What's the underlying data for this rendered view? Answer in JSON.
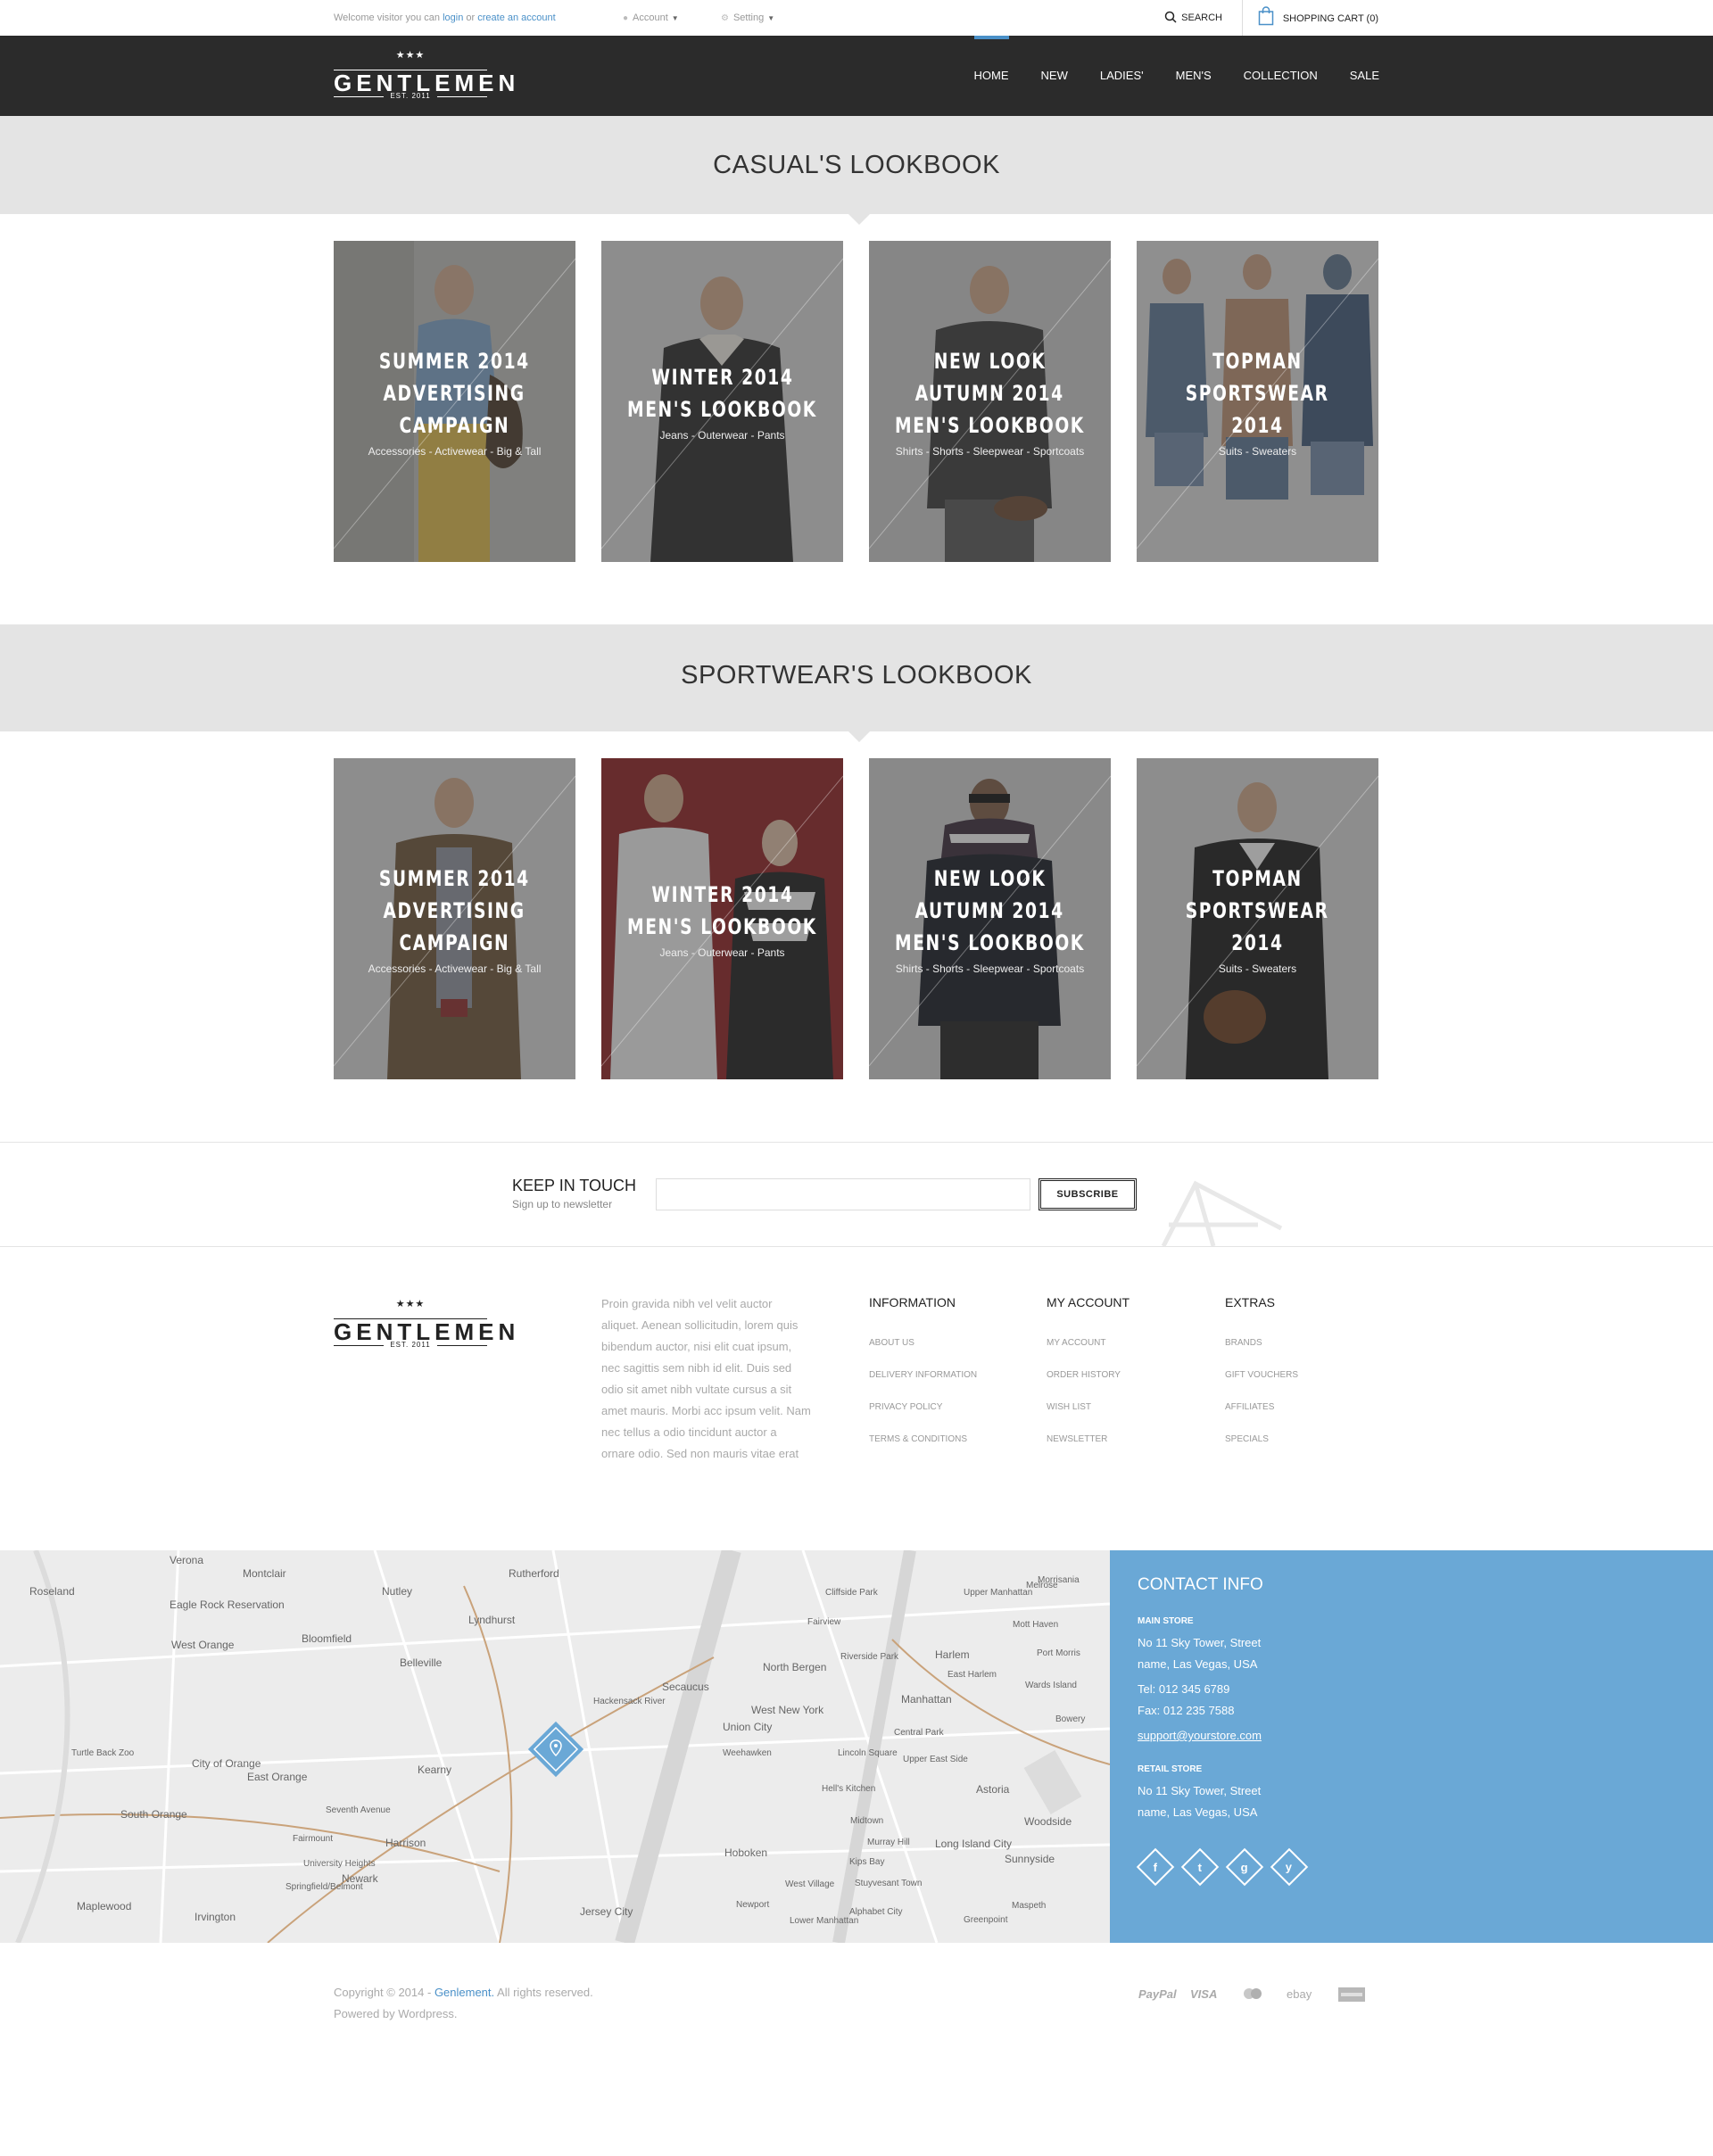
{
  "topbar": {
    "welcome_prefix": "Welcome visitor you can",
    "login": "login",
    "or": "or",
    "create_account": "create an account",
    "account": "Account",
    "setting": "Setting",
    "search": "SEARCH",
    "cart": "SHOPPING CART (0)"
  },
  "brand": {
    "stars": "★★★",
    "name": "GENTLEMEN",
    "est": "EST. 2011"
  },
  "nav": {
    "items": [
      "HOME",
      "NEW",
      "LADIES'",
      "MEN'S",
      "COLLECTION",
      "SALE"
    ]
  },
  "casual": {
    "title": "CASUAL'S LOOKBOOK",
    "cards": [
      {
        "l1": "SUMMER 2014",
        "l2": "ADVERTISING",
        "l3": "CAMPAIGN",
        "sub": "Accessories - Activewear - Big & Tall"
      },
      {
        "l1": "WINTER 2014",
        "l2": "MEN'S LOOKBOOK",
        "l3": "",
        "sub": "Jeans - Outerwear - Pants"
      },
      {
        "l1": "NEW LOOK",
        "l2": "AUTUMN 2014",
        "l3": "MEN'S LOOKBOOK",
        "sub": "Shirts - Shorts - Sleepwear - Sportcoats"
      },
      {
        "l1": "TOPMAN",
        "l2": "SPORTSWEAR",
        "l3": "2014",
        "sub": "Suits - Sweaters"
      }
    ]
  },
  "sport": {
    "title": "SPORTWEAR'S LOOKBOOK",
    "cards": [
      {
        "l1": "SUMMER 2014",
        "l2": "ADVERTISING",
        "l3": "CAMPAIGN",
        "sub": "Accessories - Activewear - Big & Tall"
      },
      {
        "l1": "WINTER 2014",
        "l2": "MEN'S LOOKBOOK",
        "l3": "",
        "sub": "Jeans - Outerwear - Pants"
      },
      {
        "l1": "NEW LOOK",
        "l2": "AUTUMN 2014",
        "l3": "MEN'S LOOKBOOK",
        "sub": "Shirts - Shorts - Sleepwear - Sportcoats"
      },
      {
        "l1": "TOPMAN",
        "l2": "SPORTSWEAR",
        "l3": "2014",
        "sub": "Suits - Sweaters"
      }
    ]
  },
  "newsletter": {
    "title": "KEEP IN TOUCH",
    "subtitle": "Sign up to newsletter",
    "placeholder": "",
    "button": "SUBSCRIBE"
  },
  "footer": {
    "about": "Proin gravida nibh vel velit auctor aliquet. Aenean sollicitudin, lorem quis bibendum auctor, nisi elit cuat ipsum, nec sagittis sem nibh id elit. Duis sed odio sit amet nibh vultate cursus a sit amet mauris. Morbi acc ipsum velit. Nam nec tellus a odio tincidunt auctor a ornare odio. Sed non  mauris vitae erat",
    "columns": [
      {
        "title": "INFORMATION",
        "links": [
          "ABOUT US",
          "DELIVERY INFORMATION",
          "PRIVACY POLICY",
          "TERMS & CONDITIONS"
        ]
      },
      {
        "title": "MY ACCOUNT",
        "links": [
          "MY ACCOUNT",
          "ORDER HISTORY",
          "WISH LIST",
          "NEWSLETTER"
        ]
      },
      {
        "title": "EXTRAS",
        "links": [
          "BRANDS",
          "GIFT VOUCHERS",
          "AFFILIATES",
          "SPECIALS"
        ]
      }
    ]
  },
  "map": {
    "labels": [
      "Verona",
      "Montclair",
      "Rutherford",
      "Nutley",
      "Lyndhurst",
      "Bloomfield",
      "West Orange",
      "Belleville",
      "Kearny",
      "East Orange",
      "Newark",
      "Harrison",
      "City of Orange",
      "South Orange",
      "Maplewood",
      "Irvington",
      "Secaucus",
      "Union City",
      "West New York",
      "North Bergen",
      "Hoboken",
      "Jersey City",
      "Manhattan",
      "Harlem",
      "Astoria",
      "Long Island City",
      "Sunnyside",
      "Woodside",
      "Roseland",
      "Eagle Rock Reservation",
      "Turtle Back Zoo",
      "Upper Manhattan",
      "Cliffside Park",
      "Fairview",
      "Weehawken",
      "Hell's Kitchen",
      "Midtown",
      "East Harlem",
      "Central Park",
      "Upper East Side",
      "Lower Manhattan",
      "West Village",
      "Kips Bay",
      "Murray Hill",
      "Newport",
      "Greenpoint",
      "Maspeth",
      "Port Morris",
      "Mott Haven",
      "Melrose",
      "Morrisania",
      "Riverside Park",
      "Wards Island",
      "Fairmount",
      "Seventh Avenue",
      "University Heights",
      "Springfield/Belmont",
      "Hackensack River",
      "Lincoln Square",
      "Stuyvesant Town",
      "Alphabet City",
      "Bowery"
    ]
  },
  "contact": {
    "title": "CONTACT INFO",
    "main_label": "MAIN STORE",
    "main_addr1": "No 11 Sky Tower, Street",
    "main_addr2": "name, Las Vegas, USA",
    "tel": "Tel: 012 345 6789",
    "fax": "Fax: 012 235 7588",
    "email": "support@yourstore.com",
    "retail_label": "RETAIL STORE",
    "retail_addr1": "No 11 Sky Tower, Street",
    "retail_addr2": "name, Las Vegas, USA",
    "social": [
      "f",
      "t",
      "g",
      "y"
    ]
  },
  "bottom": {
    "copyright_prefix": "Copyright © 2014 -",
    "brand": "Genlement.",
    "rights": "All rights reserved.",
    "powered": "Powered by Wordpress.",
    "payments": [
      "PayPal",
      "VISA",
      "mastercard",
      "ebay",
      "amex"
    ]
  },
  "colors": {
    "accent": "#4a90c8",
    "contact_bg": "#6aa8d6",
    "nav_bg": "#2b2b2b",
    "band_bg": "#e4e4e4"
  }
}
